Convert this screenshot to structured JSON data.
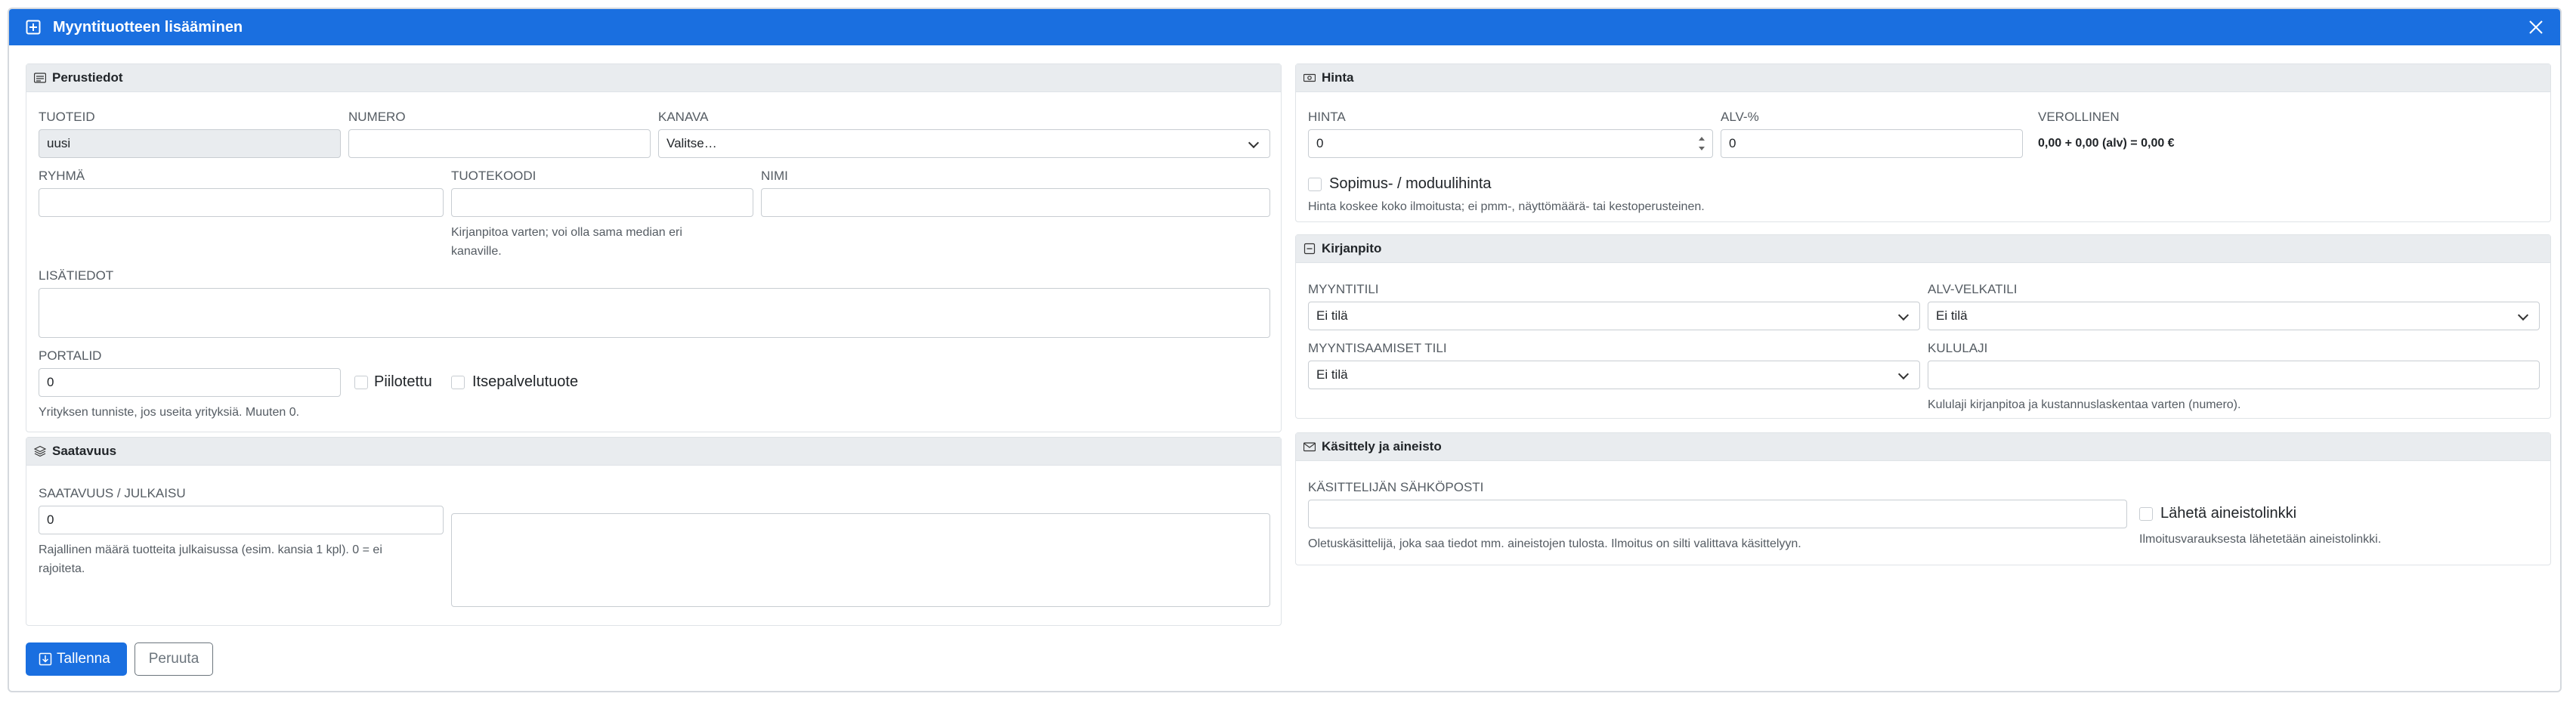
{
  "modal": {
    "title": "Myyntituotteen lisääminen"
  },
  "perustiedot": {
    "header": "Perustiedot",
    "tuoteid": {
      "label": "TUOTEID",
      "value": "uusi"
    },
    "numero": {
      "label": "NUMERO",
      "value": ""
    },
    "kanava": {
      "label": "KANAVA",
      "value": "Valitse…"
    },
    "ryhma": {
      "label": "RYHMÄ",
      "value": ""
    },
    "tuotekoodi": {
      "label": "TUOTEKOODI",
      "value": "",
      "help_1": "Kirjanpitoa varten; voi olla sama median eri",
      "help_2": "kanaville."
    },
    "nimi": {
      "label": "NIMI",
      "value": ""
    },
    "lisatiedot": {
      "label": "LISÄTIEDOT",
      "value": ""
    },
    "portalid": {
      "label": "PORTALID",
      "value": "0",
      "help": "Yrityksen tunniste, jos useita yrityksiä. Muuten 0."
    },
    "piilotettu": {
      "label": "Piilotettu",
      "checked": false
    },
    "itsepalvelu": {
      "label": "Itsepalvelutuote",
      "checked": false
    }
  },
  "saatavuus": {
    "header": "Saatavuus",
    "label": "SAATAVUUS / JULKAISU",
    "value": "0",
    "help_1": "Rajallinen määrä tuotteita julkaisussa (esim. kansia 1 kpl). 0 = ei",
    "help_2": "rajoiteta.",
    "notes": ""
  },
  "hinta": {
    "header": "Hinta",
    "hinta": {
      "label": "HINTA",
      "value": "0"
    },
    "alv": {
      "label": "ALV-%",
      "value": "0"
    },
    "verollinen": {
      "label": "VEROLLINEN",
      "value": "0,00 + 0,00 (alv) = 0,00 €"
    },
    "sopimus": {
      "label": "Sopimus- / moduulihinta",
      "checked": false
    },
    "help": "Hinta koskee koko ilmoitusta; ei pmm-, näyttömäärä- tai kestoperusteinen."
  },
  "kirjanpito": {
    "header": "Kirjanpito",
    "myyntitili": {
      "label": "MYYNTITILI",
      "value": "Ei tilä"
    },
    "alvvelkatili": {
      "label": "ALV-VELKATILI",
      "value": "Ei tilä"
    },
    "myyntisaamiset": {
      "label": "MYYNTISAAMISET TILI",
      "value": "Ei tilä"
    },
    "kululaji": {
      "label": "KULULAJI",
      "value": "",
      "help": "Kululaji kirjanpitoa ja kustannuslaskentaa varten (numero)."
    }
  },
  "kasittely": {
    "header": "Käsittely ja aineisto",
    "email": {
      "label": "KÄSITTELIJÄN SÄHKÖPOSTI",
      "value": "",
      "help": "Oletuskäsittelijä, joka saa tiedot mm. aineistojen tulosta. Ilmoitus on silti valittava käsittelyyn."
    },
    "linkki": {
      "label": "Lähetä aineistolinkki",
      "checked": false,
      "help": "Ilmoitusvarauksesta lähetetään aineistolinkki."
    }
  },
  "actions": {
    "save": "Tallenna",
    "cancel": "Peruuta"
  },
  "icons": [
    "plus-square-icon",
    "close-icon",
    "card-text-icon",
    "layers-icon",
    "cash-icon",
    "journal-icon",
    "envelope-icon",
    "save-icon"
  ],
  "colors": {
    "accent": "#1a6fe0",
    "header_bg": "#e9ecef",
    "border": "#c8cdd2"
  }
}
